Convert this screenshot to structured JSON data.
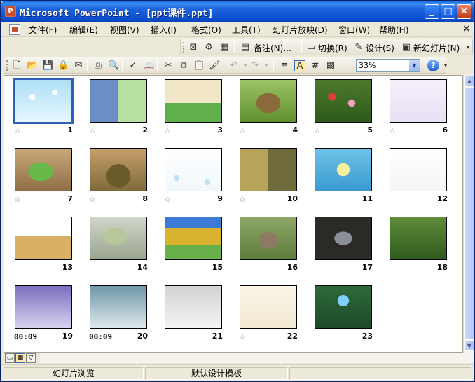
{
  "window": {
    "title": "Microsoft PowerPoint - [ppt课件.ppt]",
    "app_icon": "powerpoint-icon"
  },
  "menu": [
    "文件(F)",
    "编辑(E)",
    "视图(V)",
    "插入(I)",
    "格式(O)",
    "工具(T)",
    "幻灯片放映(D)",
    "窗口(W)",
    "帮助(H)"
  ],
  "toolbar_top": {
    "notes": "备注(N)...",
    "transition": "切换(R)",
    "design": "设计(S)",
    "new_slide": "新幻灯片(N)"
  },
  "toolbar_main": {
    "zoom": "33%"
  },
  "slides": [
    {
      "num": "1",
      "marker": "☆",
      "timing": "",
      "theme": "snow-blue",
      "selected": true
    },
    {
      "num": "2",
      "marker": "☆",
      "timing": "",
      "theme": "collage"
    },
    {
      "num": "3",
      "marker": "☆",
      "timing": "",
      "theme": "cartoon-green"
    },
    {
      "num": "4",
      "marker": "☆",
      "timing": "",
      "theme": "stump"
    },
    {
      "num": "5",
      "marker": "☆",
      "timing": "",
      "theme": "flowers"
    },
    {
      "num": "6",
      "marker": "☆",
      "timing": "",
      "theme": "white-text"
    },
    {
      "num": "7",
      "marker": "☆",
      "timing": "",
      "theme": "frog"
    },
    {
      "num": "8",
      "marker": "☆",
      "timing": "",
      "theme": "hole"
    },
    {
      "num": "9",
      "marker": "☆",
      "timing": "",
      "theme": "snow-white"
    },
    {
      "num": "10",
      "marker": "☆",
      "timing": "",
      "theme": "bees"
    },
    {
      "num": "11",
      "marker": "",
      "timing": "",
      "theme": "lilies"
    },
    {
      "num": "12",
      "marker": "",
      "timing": "",
      "theme": "geese"
    },
    {
      "num": "13",
      "marker": "",
      "timing": "",
      "theme": "cranes"
    },
    {
      "num": "14",
      "marker": "",
      "timing": "",
      "theme": "snake"
    },
    {
      "num": "15",
      "marker": "",
      "timing": "",
      "theme": "yellow-green"
    },
    {
      "num": "16",
      "marker": "",
      "timing": "",
      "theme": "hedgehog"
    },
    {
      "num": "17",
      "marker": "",
      "timing": "",
      "theme": "owl"
    },
    {
      "num": "18",
      "marker": "",
      "timing": "",
      "theme": "ant"
    },
    {
      "num": "19",
      "marker": "",
      "timing": "00:09",
      "theme": "winter-purple"
    },
    {
      "num": "20",
      "marker": "",
      "timing": "00:09",
      "theme": "winter-blue"
    },
    {
      "num": "21",
      "marker": "",
      "timing": "",
      "theme": "winter-grey"
    },
    {
      "num": "22",
      "marker": "☆",
      "timing": "",
      "theme": "paper"
    },
    {
      "num": "23",
      "marker": "",
      "timing": "",
      "theme": "blackboard"
    }
  ],
  "status": {
    "view": "幻灯片浏览",
    "template": "默认设计模板"
  }
}
